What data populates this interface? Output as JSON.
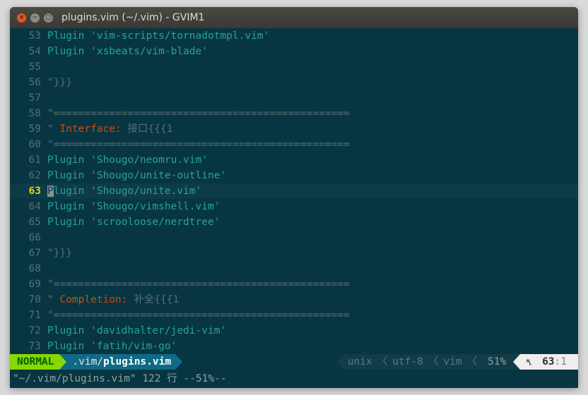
{
  "window": {
    "title": "plugins.vim (~/.vim) - GVIM1",
    "close_glyph": "×",
    "min_glyph": "−",
    "max_glyph": "□"
  },
  "lines": [
    {
      "n": "53",
      "type": "plugin",
      "kw": "Plugin ",
      "str": "'vim-scripts/tornadotmpl.vim'"
    },
    {
      "n": "54",
      "type": "plugin",
      "kw": "Plugin ",
      "str": "'xsbeats/vim-blade'"
    },
    {
      "n": "55",
      "type": "blank"
    },
    {
      "n": "56",
      "type": "comment",
      "text": "\"}}}"
    },
    {
      "n": "57",
      "type": "blank"
    },
    {
      "n": "58",
      "type": "comment",
      "text": "\"================================================"
    },
    {
      "n": "59",
      "type": "section",
      "pre": "\" ",
      "hl": "Interface:",
      "post": " 接口{{{1"
    },
    {
      "n": "60",
      "type": "comment",
      "text": "\"================================================"
    },
    {
      "n": "61",
      "type": "plugin",
      "kw": "Plugin ",
      "str": "'Shougo/neomru.vim'"
    },
    {
      "n": "62",
      "type": "plugin",
      "kw": "Plugin ",
      "str": "'Shougo/unite-outline'"
    },
    {
      "n": "63",
      "type": "cursor",
      "cur": "P",
      "kw": "lugin ",
      "str": "'Shougo/unite.vim'"
    },
    {
      "n": "64",
      "type": "plugin",
      "kw": "Plugin ",
      "str": "'Shougo/vimshell.vim'"
    },
    {
      "n": "65",
      "type": "plugin",
      "kw": "Plugin ",
      "str": "'scrooloose/nerdtree'"
    },
    {
      "n": "66",
      "type": "blank"
    },
    {
      "n": "67",
      "type": "comment",
      "text": "\"}}}"
    },
    {
      "n": "68",
      "type": "blank"
    },
    {
      "n": "69",
      "type": "comment",
      "text": "\"================================================"
    },
    {
      "n": "70",
      "type": "section",
      "pre": "\" ",
      "hl": "Completion:",
      "post": " 补全{{{1"
    },
    {
      "n": "71",
      "type": "comment",
      "text": "\"================================================"
    },
    {
      "n": "72",
      "type": "plugin",
      "kw": "Plugin ",
      "str": "'davidhalter/jedi-vim'"
    },
    {
      "n": "73",
      "type": "plugin",
      "kw": "Plugin ",
      "str": "'fatih/vim-go'"
    }
  ],
  "status": {
    "mode": "NORMAL",
    "file_dir": ".vim/",
    "file_name": "plugins.vim",
    "fileformat": "unix",
    "encoding": "utf-8",
    "filetype": "vim",
    "sep_glyph": "〈",
    "percent": "51%",
    "line_symbol": "␤",
    "line": "63",
    "col": ":1"
  },
  "cmdline": "\"~/.vim/plugins.vim\" 122 行 --51%--",
  "colors": {
    "background": "#073642",
    "keyword": "#2aa198",
    "comment": "#586e75",
    "highlight": "#cb4b16",
    "mode_bg": "#87d700",
    "file_bg": "#0f6a86"
  }
}
